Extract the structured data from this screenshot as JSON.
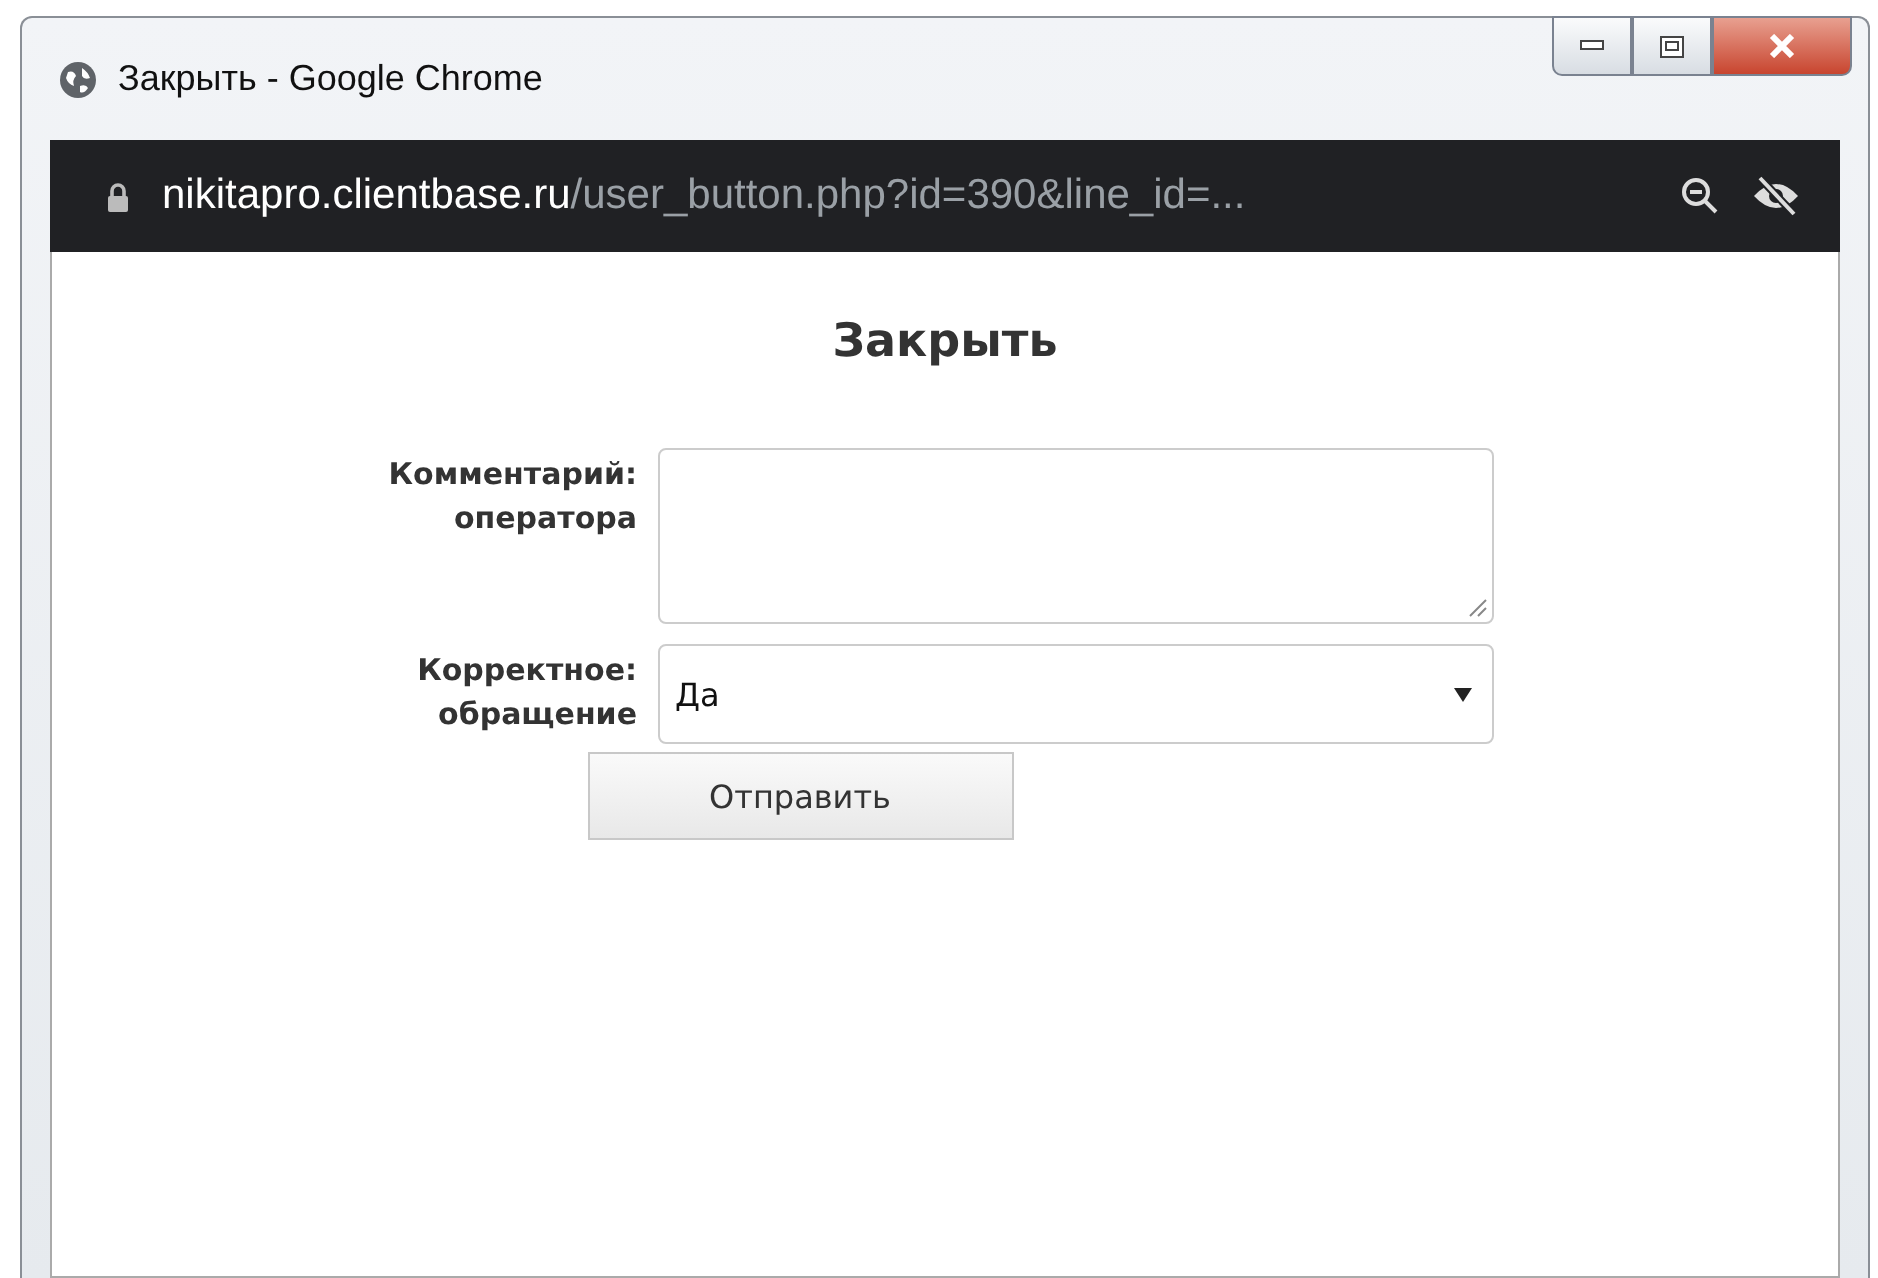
{
  "window": {
    "title": "Закрыть - Google Chrome"
  },
  "address_bar": {
    "domain": "nikitapro.clientbase.ru",
    "path": "/user_button.php?id=390&line_id=..."
  },
  "page": {
    "heading": "Закрыть",
    "fields": [
      {
        "kind": "textarea",
        "label": "Комментарий: оператора"
      },
      {
        "kind": "select",
        "label": "Корректное: обращение",
        "value": "Да"
      }
    ],
    "submit": "Отправить"
  }
}
